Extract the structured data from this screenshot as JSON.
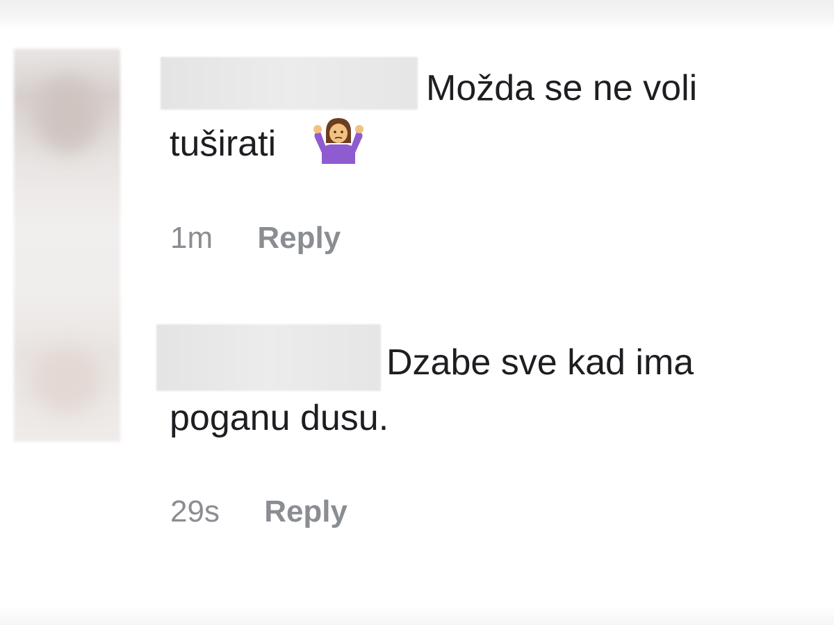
{
  "comments": [
    {
      "text_line1": "Možda se ne voli",
      "text_line2": "tuširati",
      "emoji": "person-shrugging-icon",
      "time": "1m",
      "reply_label": "Reply"
    },
    {
      "text_line1": "Dzabe sve kad ima",
      "text_line2": "poganu dusu.",
      "time": "29s",
      "reply_label": "Reply"
    }
  ],
  "colors": {
    "text": "#1c1e21",
    "meta": "#8a8d91",
    "emoji_shirt": "#8e5bd0",
    "emoji_hair": "#6b3e1f",
    "emoji_skin": "#f2c182"
  }
}
